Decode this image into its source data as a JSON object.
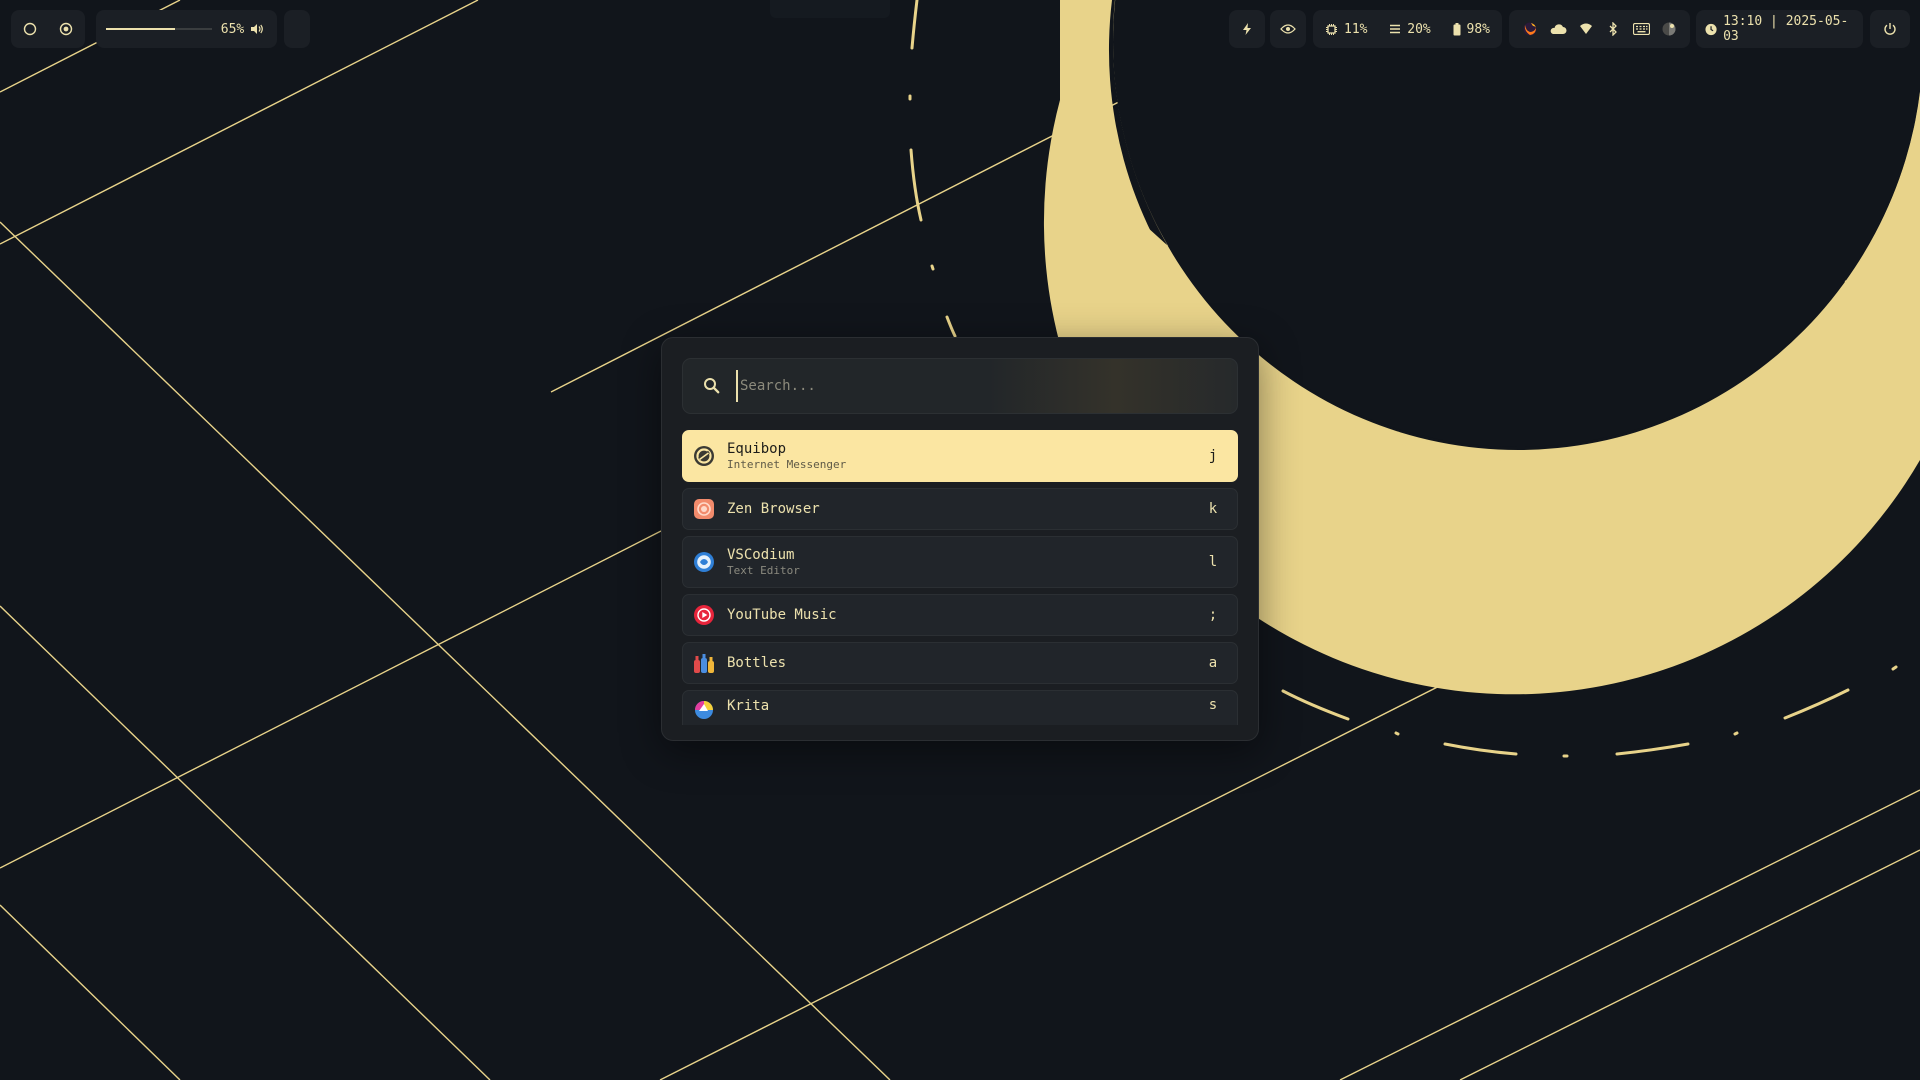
{
  "topbar": {
    "left_icons": [
      "circle-outline-icon",
      "record-icon"
    ],
    "volume": {
      "level": 0.65,
      "label": "65%",
      "icon": "speaker-icon"
    },
    "quick_icons": [
      "bolt-icon",
      "eye-icon"
    ],
    "stats": {
      "cpu": {
        "icon": "cpu-icon",
        "value": "11%"
      },
      "memory": {
        "icon": "memory-icon",
        "value": "20%"
      },
      "battery": {
        "icon": "battery-icon",
        "value": "98%"
      }
    },
    "tray_icons": [
      "firefox-icon",
      "cloud-icon",
      "wifi-icon",
      "bluetooth-icon",
      "keyboard-icon",
      "darkmode-icon"
    ],
    "clock": {
      "icon": "clock-icon",
      "text": "13:10 | 2025-05-03"
    },
    "power_icon": "power-icon"
  },
  "launcher": {
    "search": {
      "placeholder": "Search...",
      "value": ""
    },
    "results": [
      {
        "name": "Equibop",
        "description": "Internet Messenger",
        "key": "j",
        "icon": "equibop-icon",
        "active": true
      },
      {
        "name": "Zen Browser",
        "description": "",
        "key": "k",
        "icon": "zen-browser-icon",
        "active": false
      },
      {
        "name": "VSCodium",
        "description": "Text Editor",
        "key": "l",
        "icon": "vscodium-icon",
        "active": false
      },
      {
        "name": "YouTube Music",
        "description": "",
        "key": ";",
        "icon": "youtube-music-icon",
        "active": false
      },
      {
        "name": "Bottles",
        "description": "",
        "key": "a",
        "icon": "bottles-icon",
        "active": false
      },
      {
        "name": "Krita",
        "description": "",
        "key": "s",
        "icon": "krita-icon",
        "active": false
      }
    ]
  },
  "colors": {
    "background": "#11151b",
    "accent": "#ece1ad",
    "wallpaper_gold": "#e8d38a",
    "highlight": "#fbe6a2"
  }
}
